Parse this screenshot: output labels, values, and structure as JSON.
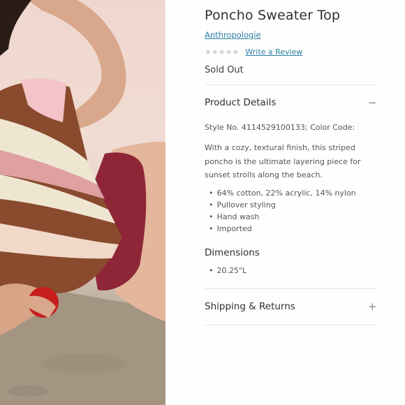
{
  "product": {
    "title": "Poncho Sweater Top",
    "brand": "Anthropologie",
    "review_link": "Write a Review",
    "stars": [
      "★",
      "★",
      "★",
      "★",
      "★"
    ],
    "availability": "Sold Out"
  },
  "details": {
    "heading": "Product Details",
    "toggle": "−",
    "style_line": "Style No. 4114529100133; Color Code:",
    "description": "With a cozy, textural finish, this striped poncho is the ultimate layering piece for sunset strolls along the beach.",
    "features": [
      "64% cotton, 22% acrylic, 14% nylon",
      "Pullover styling",
      "Hand wash",
      "Imported"
    ]
  },
  "dimensions": {
    "heading": "Dimensions",
    "items": [
      "20.25\"L"
    ]
  },
  "shipping": {
    "heading": "Shipping & Returns",
    "toggle": "+"
  },
  "colors": {
    "link": "#2b7fa6",
    "star_empty": "#cfcfcf",
    "sweater_brown": "#8a4a2e",
    "sweater_cream": "#efe6d2",
    "sweater_pink": "#f3b6bd",
    "swimsuit": "#8e2638",
    "apple": "#c81e1e"
  }
}
